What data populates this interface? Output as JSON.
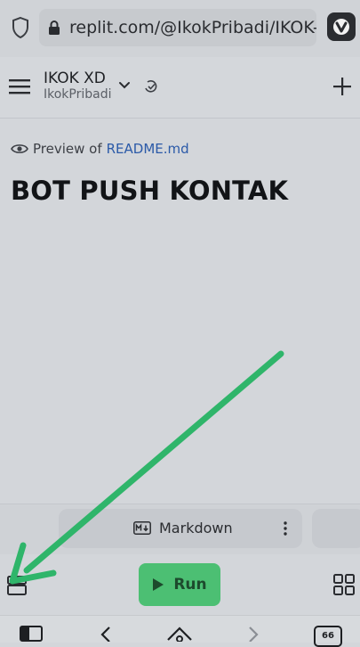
{
  "browser": {
    "url": "replit.com/@IkokPribadi/IKOK-XD"
  },
  "repl": {
    "name": "IKOK XD",
    "owner": "IkokPribadi"
  },
  "preview": {
    "prefix": "Preview of",
    "file": "README.md",
    "title": "BOT PUSH KONTAK"
  },
  "tabs": {
    "active_label": "Markdown"
  },
  "toolbar": {
    "run_label": "Run"
  },
  "system_nav": {
    "tab_count": "66"
  },
  "colors": {
    "run_green": "#4cbf73",
    "arrow_green": "#2fb56a",
    "link_blue": "#2b5aa8"
  }
}
